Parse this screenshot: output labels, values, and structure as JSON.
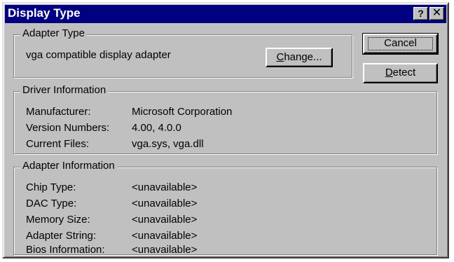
{
  "window": {
    "title": "Display Type",
    "help_glyph": "?",
    "close_glyph": "✕"
  },
  "adapter_type": {
    "label": "Adapter Type",
    "adapter_name": "vga compatible display adapter",
    "change_button": {
      "mnemonic": "C",
      "rest": "hange..."
    }
  },
  "buttons": {
    "cancel": "Cancel",
    "detect": {
      "mnemonic": "D",
      "rest": "etect"
    }
  },
  "driver_info": {
    "label": "Driver Information",
    "rows": [
      {
        "key": "Manufacturer:",
        "value": "Microsoft Corporation"
      },
      {
        "key": "Version Numbers:",
        "value": "4.00, 4.0.0"
      },
      {
        "key": "Current Files:",
        "value": "vga.sys, vga.dll"
      }
    ]
  },
  "adapter_info": {
    "label": "Adapter Information",
    "rows": [
      {
        "key": "Chip Type:",
        "value": "<unavailable>"
      },
      {
        "key": "DAC Type:",
        "value": "<unavailable>"
      },
      {
        "key": "Memory Size:",
        "value": "<unavailable>"
      },
      {
        "key": "Adapter String:",
        "value": "<unavailable>"
      },
      {
        "key": "Bios Information:",
        "value": "<unavailable>"
      }
    ]
  }
}
